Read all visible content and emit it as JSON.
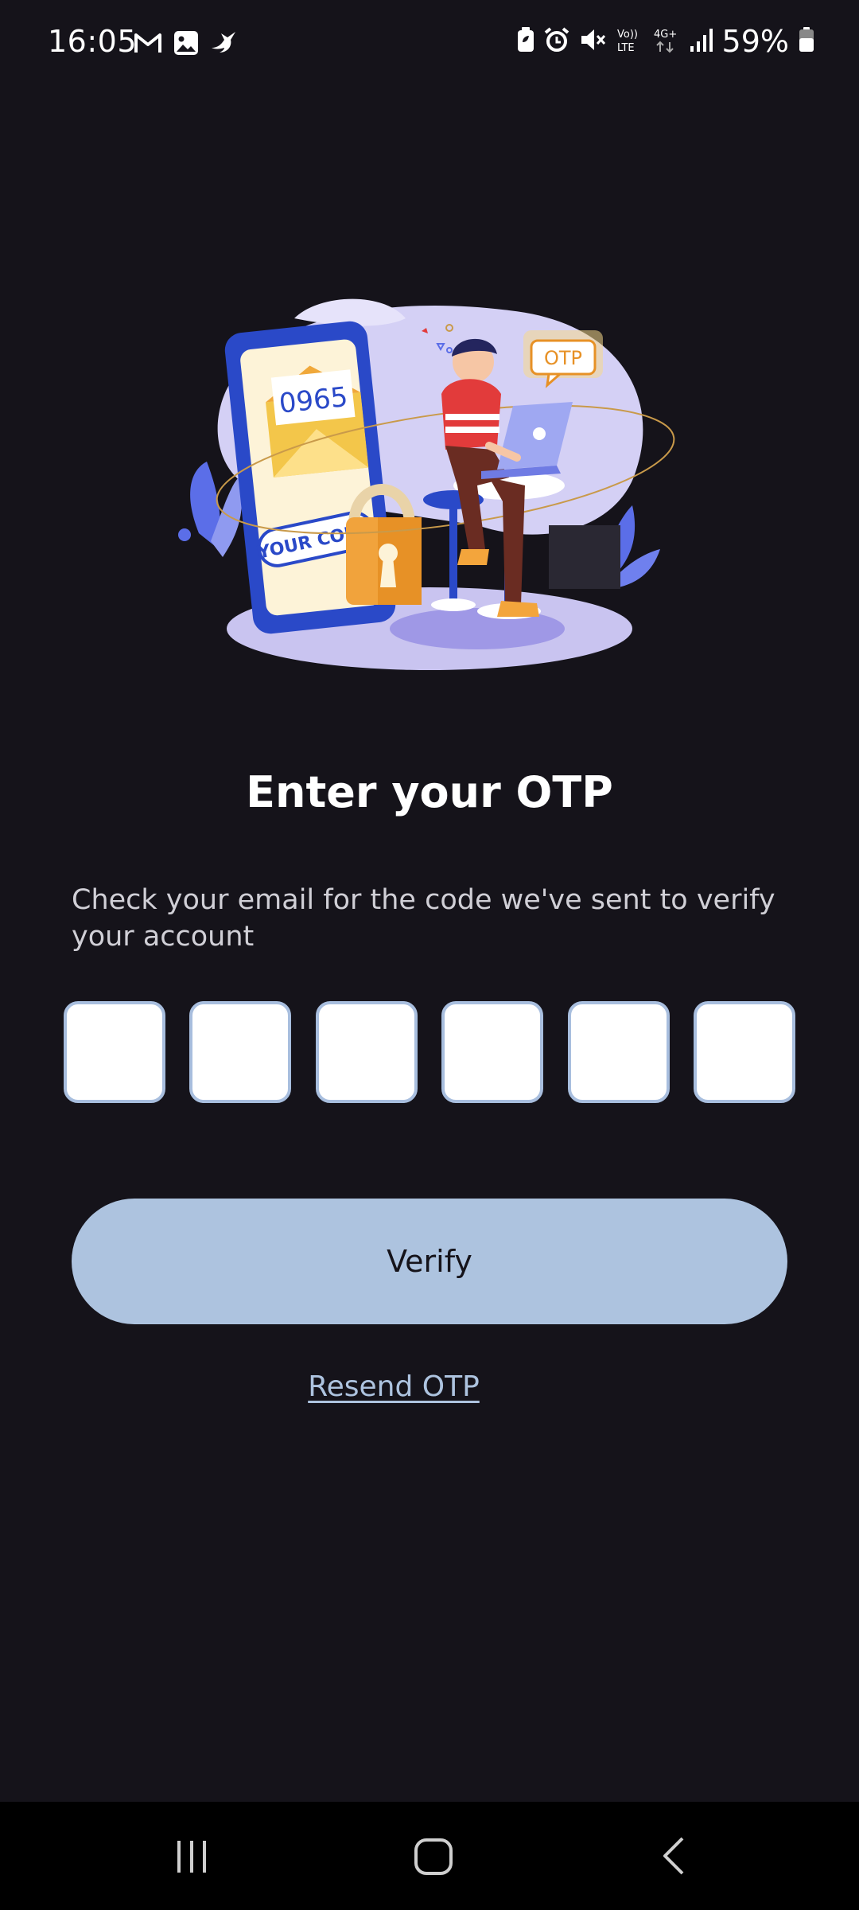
{
  "status_bar": {
    "time": "16:05",
    "battery_percent": "59%",
    "left_icons": [
      "gmail-icon",
      "gallery-icon",
      "bird-app-icon"
    ],
    "right_icons": [
      "battery-saver-icon",
      "alarm-icon",
      "mute-icon",
      "volte-icon",
      "4g-icon",
      "signal-icon",
      "battery-icon"
    ],
    "volte_label": "Vo)) LTE",
    "network_label": "4G+"
  },
  "illustration": {
    "code_text": "0965",
    "badge_text": "OTP",
    "card_text": "YOUR CODE"
  },
  "main": {
    "title": "Enter your OTP",
    "subtitle": "Check your email for the code we've sent to verify your account",
    "otp_digits": [
      "",
      "",
      "",
      "",
      "",
      ""
    ],
    "verify_label": "Verify",
    "resend_label": "Resend OTP"
  },
  "nav_bar": {
    "buttons": [
      "recent-apps",
      "home",
      "back"
    ]
  },
  "colors": {
    "background": "#15131a",
    "accent": "#adc3df",
    "otp_border": "#a8bede"
  }
}
